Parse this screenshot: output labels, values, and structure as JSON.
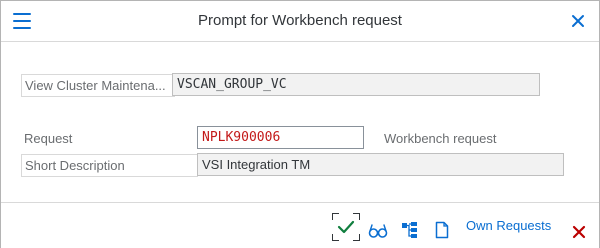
{
  "dialog": {
    "title": "Prompt for Workbench request"
  },
  "fields": {
    "view_cluster": {
      "label": "View Cluster Maintena...",
      "value": "VSCAN_GROUP_VC"
    },
    "request": {
      "label": "Request",
      "value": "NPLK900006",
      "info": "Workbench request"
    },
    "short_description": {
      "label": "Short Description",
      "value": "VSI Integration TM"
    }
  },
  "footer": {
    "own_requests_label": "Own Requests"
  },
  "icons": {
    "menu": "hamburger-icon",
    "close": "close-icon",
    "confirm": "checkmark-icon",
    "display": "glasses-icon",
    "hierarchy": "hierarchy-icon",
    "new": "document-icon",
    "cancel": "cancel-icon"
  },
  "colors": {
    "accent": "#0a6ed1",
    "confirm": "#107e3e",
    "cancel": "#bb0000",
    "request_value": "#c31919"
  }
}
